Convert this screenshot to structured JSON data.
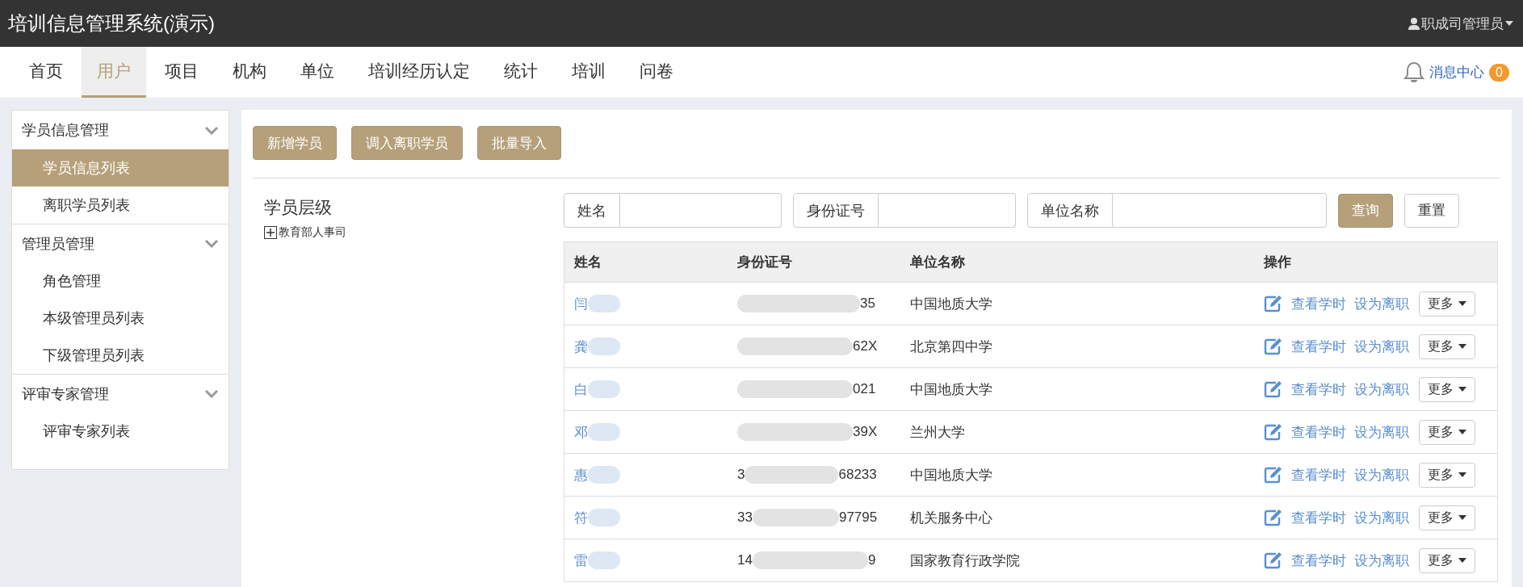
{
  "header": {
    "title": "培训信息管理系统(演示)",
    "user": "职成司管理员"
  },
  "nav": {
    "tabs": [
      {
        "label": "首页",
        "selected": false
      },
      {
        "label": "用户",
        "selected": true
      },
      {
        "label": "项目",
        "selected": false
      },
      {
        "label": "机构",
        "selected": false
      },
      {
        "label": "单位",
        "selected": false
      },
      {
        "label": "培训经历认定",
        "selected": false
      },
      {
        "label": "统计",
        "selected": false
      },
      {
        "label": "培训",
        "selected": false
      },
      {
        "label": "问卷",
        "selected": false
      }
    ],
    "messages": {
      "label": "消息中心",
      "count": "0"
    }
  },
  "sidebar": {
    "groups": [
      {
        "title": "学员信息管理",
        "items": [
          {
            "label": "学员信息列表",
            "selected": true
          },
          {
            "label": "离职学员列表",
            "selected": false
          }
        ]
      },
      {
        "title": "管理员管理",
        "items": [
          {
            "label": "角色管理",
            "selected": false
          },
          {
            "label": "本级管理员列表",
            "selected": false
          },
          {
            "label": "下级管理员列表",
            "selected": false
          }
        ]
      },
      {
        "title": "评审专家管理",
        "items": [
          {
            "label": "评审专家列表",
            "selected": false
          }
        ]
      }
    ]
  },
  "toolbar": {
    "buttons": [
      "新增学员",
      "调入离职学员",
      "批量导入"
    ]
  },
  "tree": {
    "title": "学员层级",
    "nodes": [
      {
        "label": "教育部人事司",
        "expanded": false
      }
    ]
  },
  "search": {
    "fields": [
      {
        "label": "姓名"
      },
      {
        "label": "身份证号"
      },
      {
        "label": "单位名称"
      }
    ],
    "query": "查询",
    "reset": "重置"
  },
  "table": {
    "columns": [
      "姓名",
      "身份证号",
      "单位名称",
      "操作"
    ],
    "rows": [
      {
        "name": "闫",
        "id_start": "",
        "id_end": "35",
        "unit": "中国地质大学",
        "actions": {
          "hours": "查看学时",
          "leave": "设为离职",
          "more": "更多"
        }
      },
      {
        "name": "龚",
        "id_start": "",
        "id_end": "62X",
        "unit": "北京第四中学",
        "actions": {
          "hours": "查看学时",
          "leave": "设为离职",
          "more": "更多"
        }
      },
      {
        "name": "白",
        "id_start": "",
        "id_end": "021",
        "unit": "中国地质大学",
        "actions": {
          "hours": "查看学时",
          "leave": "设为离职",
          "more": "更多"
        }
      },
      {
        "name": "邓",
        "id_start": "",
        "id_end": "39X",
        "unit": "兰州大学",
        "actions": {
          "hours": "查看学时",
          "leave": "设为离职",
          "more": "更多"
        }
      },
      {
        "name": "惠",
        "id_start": "3",
        "id_end": "68233",
        "unit": "中国地质大学",
        "actions": {
          "hours": "查看学时",
          "leave": "设为离职",
          "more": "更多"
        }
      },
      {
        "name": "符",
        "id_start": "33",
        "id_end": "97795",
        "unit": "机关服务中心",
        "actions": {
          "hours": "查看学时",
          "leave": "设为离职",
          "more": "更多"
        }
      },
      {
        "name": "雷",
        "id_start": "14",
        "id_end": "9",
        "unit": "国家教育行政学院",
        "actions": {
          "hours": "查看学时",
          "leave": "设为离职",
          "more": "更多"
        }
      }
    ]
  }
}
